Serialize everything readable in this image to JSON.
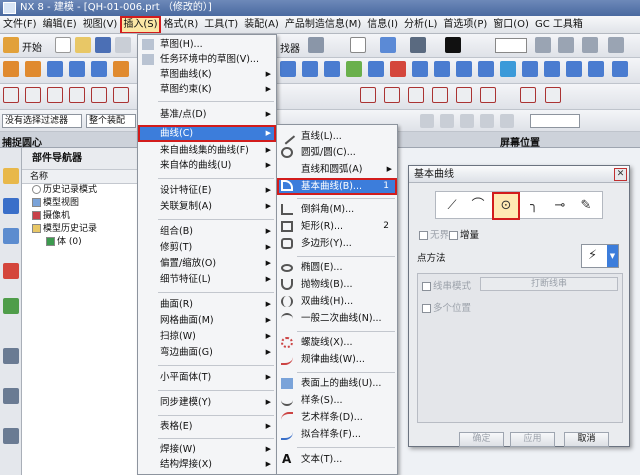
{
  "window": {
    "title": "NX 8 - 建模 - [QH-01-006.prt （修改的）]"
  },
  "menubar": {
    "items": [
      "文件(F)",
      "编辑(E)",
      "视图(V)",
      "插入(S)",
      "格式(R)",
      "工具(T)",
      "装配(A)",
      "产品制造信息(M)",
      "信息(I)",
      "分析(L)",
      "首选项(P)",
      "窗口(O)",
      "GC 工具箱"
    ],
    "active_index": 3
  },
  "toolbar": {
    "start_label": "开始",
    "fragment_right": "找器",
    "filter_value": "没有选择过滤器",
    "assembly_value": "整个装配",
    "status_right": "屏幕位置"
  },
  "left_panel": {
    "snap_label": "捕捉圆心",
    "navigator_title": "部件导航器",
    "column_header": "名称",
    "tree": [
      {
        "label": "历史记录模式",
        "icon": "history-icon"
      },
      {
        "label": "模型视图",
        "icon": "model-view-icon"
      },
      {
        "label": "摄像机",
        "icon": "camera-icon"
      },
      {
        "label": "模型历史记录",
        "icon": "folder-icon"
      },
      {
        "label": "体 (0)",
        "icon": "body-icon"
      }
    ]
  },
  "insert_menu": {
    "items": [
      {
        "label": "草图(H)...",
        "arrow": false
      },
      {
        "label": "任务环境中的草图(V)...",
        "arrow": false
      },
      {
        "label": "草图曲线(K)",
        "arrow": true
      },
      {
        "label": "草图约束(K)",
        "arrow": true
      },
      {
        "label": "基准/点(D)",
        "arrow": true
      },
      {
        "label": "曲线(C)",
        "arrow": true
      },
      {
        "label": "来自曲线集的曲线(F)",
        "arrow": true
      },
      {
        "label": "来自体的曲线(U)",
        "arrow": true
      },
      {
        "label": "设计特征(E)",
        "arrow": true
      },
      {
        "label": "关联复制(A)",
        "arrow": true
      },
      {
        "label": "组合(B)",
        "arrow": true
      },
      {
        "label": "修剪(T)",
        "arrow": true
      },
      {
        "label": "偏置/缩放(O)",
        "arrow": true
      },
      {
        "label": "细节特征(L)",
        "arrow": true
      },
      {
        "label": "曲面(R)",
        "arrow": true
      },
      {
        "label": "网格曲面(M)",
        "arrow": true
      },
      {
        "label": "扫掠(W)",
        "arrow": true
      },
      {
        "label": "弯边曲面(G)",
        "arrow": true
      },
      {
        "label": "小平面体(T)",
        "arrow": true
      },
      {
        "label": "同步建模(Y)",
        "arrow": true
      },
      {
        "label": "表格(E)",
        "arrow": true
      },
      {
        "label": "焊接(W)",
        "arrow": true
      },
      {
        "label": "结构焊接(X)",
        "arrow": true
      }
    ]
  },
  "curve_menu": {
    "items": [
      {
        "label": "直线(L)...",
        "key": "",
        "arrow": false,
        "icon": "line-icon"
      },
      {
        "label": "圆弧/圆(C)...",
        "key": "",
        "arrow": false,
        "icon": "arc-icon"
      },
      {
        "label": "直线和圆弧(A)",
        "key": "",
        "arrow": true,
        "icon": ""
      },
      {
        "label": "基本曲线(B)...",
        "key": "1",
        "arrow": false,
        "icon": "basic-curve-icon"
      },
      {
        "label": "倒斜角(M)...",
        "key": "",
        "arrow": false,
        "icon": "chamfer-icon"
      },
      {
        "label": "矩形(R)...",
        "key": "2",
        "arrow": false,
        "icon": "rectangle-icon"
      },
      {
        "label": "多边形(Y)...",
        "key": "",
        "arrow": false,
        "icon": "polygon-icon"
      },
      {
        "label": "椭圆(E)...",
        "key": "",
        "arrow": false,
        "icon": "ellipse-icon"
      },
      {
        "label": "抛物线(B)...",
        "key": "",
        "arrow": false,
        "icon": "parabola-icon"
      },
      {
        "label": "双曲线(H)...",
        "key": "",
        "arrow": false,
        "icon": "hyperbola-icon"
      },
      {
        "label": "一般二次曲线(N)...",
        "key": "",
        "arrow": false,
        "icon": "conic-icon"
      },
      {
        "label": "螺旋线(X)...",
        "key": "",
        "arrow": false,
        "icon": "helix-icon"
      },
      {
        "label": "规律曲线(W)...",
        "key": "",
        "arrow": false,
        "icon": "law-curve-icon"
      },
      {
        "label": "表面上的曲线(U)...",
        "key": "",
        "arrow": false,
        "icon": "curve-on-surface-icon"
      },
      {
        "label": "样条(S)...",
        "key": "",
        "arrow": false,
        "icon": "spline-icon"
      },
      {
        "label": "艺术样条(D)...",
        "key": "",
        "arrow": false,
        "icon": "studio-spline-icon"
      },
      {
        "label": "拟合样条(F)...",
        "key": "",
        "arrow": false,
        "icon": "fit-spline-icon"
      },
      {
        "label": "文本(T)...",
        "key": "",
        "arrow": false,
        "icon": "text-icon"
      }
    ]
  },
  "dialog": {
    "title": "基本曲线",
    "infinite_label": "无界",
    "incremental_label": "增量",
    "point_method_label": "点方法",
    "string_mode_label": "线串模式",
    "break_string_label": "打断线串",
    "multi_position_label": "多个位置",
    "ok_label": "确定",
    "apply_label": "应用",
    "cancel_label": "取消"
  }
}
